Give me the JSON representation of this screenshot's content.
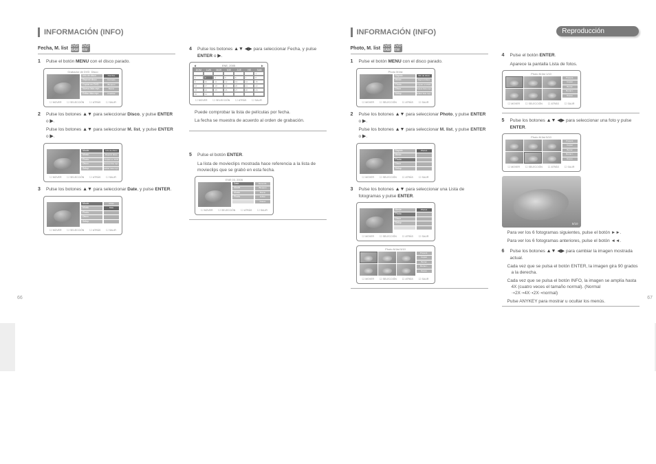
{
  "leftPage": {
    "number": "66",
    "title": "INFORMACIÓN (INFO)",
    "section": {
      "title": "Fecha, M. list",
      "iconBadges": [
        "DVD-RAM",
        "DVD-RW"
      ]
    },
    "s1": {
      "num": "1",
      "textA": "Pulse el botón ",
      "menu": "MENU",
      "textB": " con el disco parado.",
      "screen": {
        "header": "Grabador de DVD",
        "meta": "Disco",
        "items": [
          "Info de disco",
          "Reprod disco",
          "Copiar en DVD",
          "Nueva lista repr.",
          "Editar lista repr."
        ],
        "right": [
          "Nombre",
          "Formato",
          "Bloqueo",
          "Borrar",
          "Finalizar"
        ],
        "footer": [
          "MOVER",
          "SELECCIÓN",
          "ATRÁS",
          "SALIR"
        ]
      }
    },
    "s2": {
      "num": "2",
      "line1a": "Pulse los botones ",
      "line1b": " para seleccionar ",
      "target1": "Disco",
      "line1c": ", y pulse ",
      "enter": "ENTER",
      "or": " o ",
      "line2a": "Pulse los botones ",
      "line2b": " para seleccionar ",
      "target2": "M. list",
      "line2c": ", y pulse ",
      "screen": {
        "items": [
          "Movie",
          "Music",
          "Photo",
          "Disco",
          "Setup"
        ],
        "sub": [
          "Info de disco",
          "Reprod disco",
          "Copiar en DVD",
          "Nueva lista repr.",
          "Editar lista repr."
        ]
      }
    },
    "s3": {
      "num": "3",
      "textA": "Pulse los botones ",
      "textB": " para seleccionar ",
      "target": "Date",
      "textC": ", y pulse ",
      "screen": {
        "items": [
          "Movie",
          "Music",
          "Photo",
          "Disco",
          "Setup"
        ],
        "sub": [
          "M.list",
          "Date"
        ]
      }
    },
    "right": {
      "s4": {
        "num": "4",
        "textA": "Pulse los botones ",
        "textB": " para seleccionar Fecha, y pulse ",
        "calendar": {
          "monthYear": "ENE, 2005",
          "days": [
            "DOM",
            "LUN",
            "MAR",
            "MIE",
            "JUE",
            "VIE",
            "SAB"
          ],
          "cells": [
            "",
            "",
            "",
            "",
            "",
            "",
            "1",
            "2",
            "3",
            "4",
            "5",
            "6",
            "7",
            "8",
            "9",
            "10",
            "11",
            "12",
            "13",
            "14",
            "15",
            "16",
            "17",
            "18",
            "19",
            "20",
            "21",
            "22",
            "23",
            "24",
            "25",
            "26",
            "27",
            "28",
            "29",
            "30",
            "31",
            "",
            "",
            "",
            "",
            ""
          ],
          "footer": [
            "MOVER",
            "SELECCIÓN",
            "ATRÁS",
            "SALIR"
          ]
        },
        "bullet1": "Puede comprobar la lista de películas por fecha.",
        "bullet2": "La fecha se muestra de acuerdo al orden de grabación."
      },
      "s5": {
        "num": "5",
        "textA": "Pulse el botón ",
        "textB": "La lista de movieclips mostrada hace referencia a la lista de movieclips que se grabó en esta fecha.",
        "screen": {
          "items": [
            "Date",
            "Movie",
            "Music",
            "Photo"
          ],
          "thumbTitle": "ENE 03, 2005",
          "sub": [
            "Renomb.",
            "Bloqueo",
            "Borrar",
            "Editar",
            "Nuevo"
          ]
        }
      }
    }
  },
  "rightPage": {
    "number": "67",
    "banner": "Reproducción",
    "title": "INFORMACIÓN (INFO)",
    "section": {
      "title": "Photo, M. list",
      "iconBadges": [
        "DVD-RAM",
        "DVD-RW"
      ]
    },
    "s1": {
      "num": "1",
      "textA": "Pulse el botón ",
      "menu": "MENU",
      "textB": " con el disco parado.",
      "s4num": "4",
      "s4a": "Pulse el botón ",
      "s4enter": "ENTER",
      "s4b": "Aparece la pantalla Lista de fotos.",
      "screenA": {
        "title": "Photo M.list",
        "items": [
          "Rápido",
          "Music",
          "Photo",
          "Disco",
          "Setup"
        ],
        "sub": [
          "Info de disco",
          "Reprod disco",
          "Copiar en DVD",
          "Nueva lista repr.",
          "Editar lista repr."
        ]
      },
      "thumbScreen": {
        "header": "Photo M.list   1/10",
        "sub": [
          "Present.",
          "Copiar",
          "Borrar",
          "Borrar t.",
          "Nuevo"
        ]
      }
    },
    "s2": {
      "num": "2",
      "line1a": "Pulse los botones ",
      "line1b": " para seleccionar ",
      "target1": "Photo",
      "line1c": ", y pulse ",
      "enter": "ENTER",
      "or": " o ",
      "line2a": "Pulse los botones ",
      "line2b": " para seleccionar ",
      "target2": "M. list",
      "line2c": ", y pulse ",
      "s5num": "5",
      "s5a": "Pulse los botones ",
      "s5b": " para seleccionar una foto y pulse ",
      "thumbScreen": {
        "header": "Photo M.list   5/10"
      },
      "bullet1": "Para ver los 6 fotogramas siguientes, pulse el botón ►►.",
      "bullet2": "Para ver los 6 fotogramas anteriores, pulse el botón ◄◄."
    },
    "s6": {
      "num": "6",
      "textA": "Pulse los botones ",
      "textB": " para cambiar la imagen mostrada actual.",
      "bigLabel": "5/10",
      "bullets": [
        "Cada vez que se pulsa el botón ENTER, la imagen gira 90 grados a la derecha.",
        "Cada vez que se pulsa el botón INFO, la imagen se amplía hasta 4X (cuatro veces el tamaño normal). (Normal ➝2X➝4X➝2X➝normal)",
        "Pulse ANYKEY para mostrar u ocultar los menús."
      ]
    },
    "s3": {
      "num": "3",
      "textA": "Pulse los botones ",
      "textB": " para seleccionar una Lista de fotogramas y pulse ",
      "screenA": {
        "items": [
          "Movie",
          "Photo",
          "Disco",
          "Setup"
        ],
        "title": "Photo1"
      },
      "thumbScreen": {
        "header": "Photo M.list   5/10"
      }
    },
    "sidebarLabel": "Reproducción"
  }
}
